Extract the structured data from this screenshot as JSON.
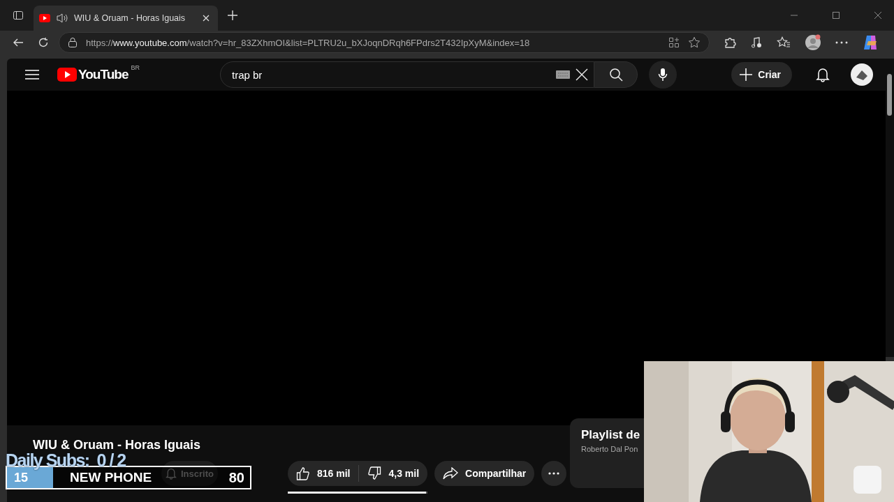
{
  "browser": {
    "tab": {
      "title": "WIU & Oruam - Horas Iguais",
      "selected": true
    },
    "url": {
      "scheme": "https://",
      "host": "www.youtube.com",
      "path": "/watch?v=hr_83ZXhmOI&list=PLTRU2u_bXJoqnDRqh6FPdrs2T432IpXyM&index=18"
    }
  },
  "youtube": {
    "logo_text": "YouTube",
    "region": "BR",
    "search": {
      "value": "trap br"
    },
    "create_label": "Criar",
    "video": {
      "title": "WIU & Oruam - Horas Iguais",
      "subscribe_label": "Inscrito",
      "likes": "816 mil",
      "dislikes": "4,3 mil",
      "share_label": "Compartilhar",
      "like_ratio": {
        "level": 0.99
      }
    },
    "playlist": {
      "title": "Playlist de",
      "owner": "Roberto Dal Pon"
    }
  },
  "overlay": {
    "goal_label": "Daily Subs:  0 / 2",
    "bar": {
      "current": "15",
      "label": "NEW PHONE",
      "target": "80",
      "level": 0.19
    }
  }
}
